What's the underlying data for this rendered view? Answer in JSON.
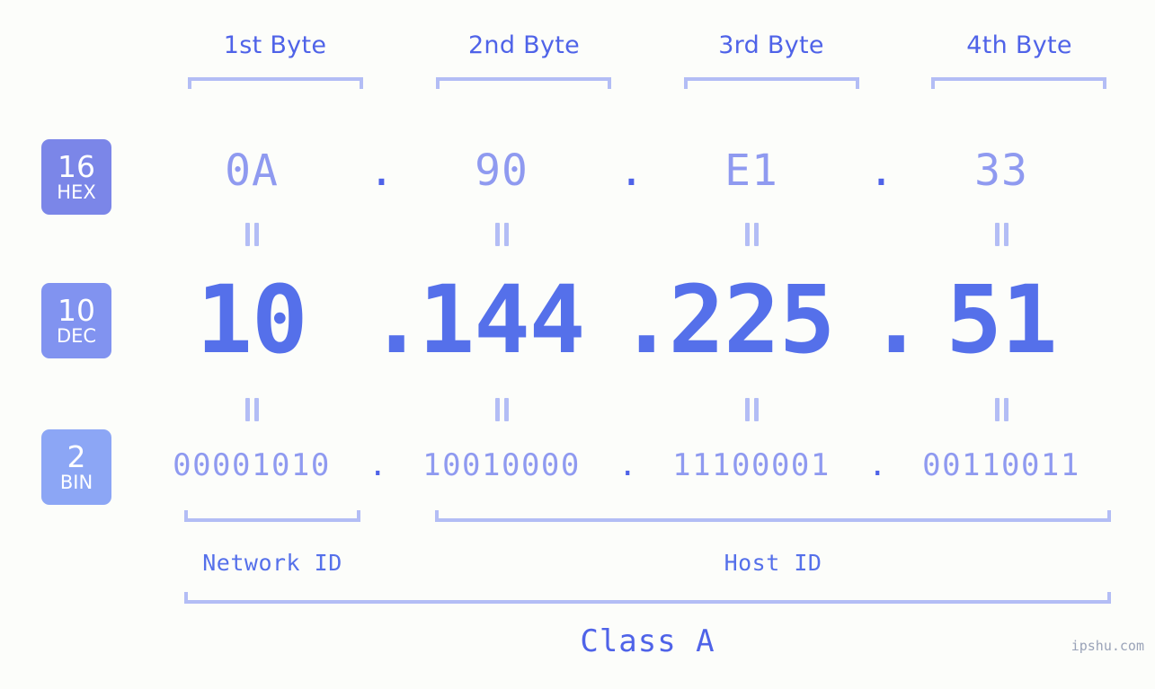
{
  "page": {
    "background_color": "#fcfdfa",
    "accent_color": "#5570ea",
    "muted_accent_color": "#8f9af0",
    "bracket_color": "#b3bdf5",
    "watermark": "ipshu.com"
  },
  "byte_headers": [
    {
      "label": "1st Byte"
    },
    {
      "label": "2nd Byte"
    },
    {
      "label": "3rd Byte"
    },
    {
      "label": "4th Byte"
    }
  ],
  "radix_badges": [
    {
      "number": "16",
      "name": "HEX",
      "color": "#7b86e8"
    },
    {
      "number": "10",
      "name": "DEC",
      "color": "#8193f0"
    },
    {
      "number": "2",
      "name": "BIN",
      "color": "#8ca6f5"
    }
  ],
  "rows": {
    "hex": {
      "radix": "16",
      "radix_name": "HEX",
      "octets": [
        "0A",
        "90",
        "E1",
        "33"
      ],
      "separator": "."
    },
    "dec": {
      "radix": "10",
      "radix_name": "DEC",
      "octets": [
        "10",
        "144",
        "225",
        "51"
      ],
      "separator": "."
    },
    "bin": {
      "radix": "2",
      "radix_name": "BIN",
      "octets": [
        "00001010",
        "10010000",
        "11100001",
        "00110011"
      ],
      "separator": "."
    }
  },
  "equality_marks": {
    "glyph": "=",
    "count_per_row": 4
  },
  "id_sections": [
    {
      "label": "Network ID"
    },
    {
      "label": "Host ID"
    }
  ],
  "class_section": {
    "label": "Class A"
  }
}
